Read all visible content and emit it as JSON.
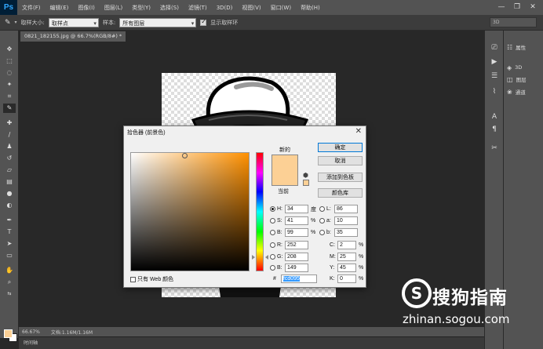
{
  "app": {
    "logo": "Ps"
  },
  "menu": [
    "文件(F)",
    "编辑(E)",
    "图像(I)",
    "图层(L)",
    "类型(Y)",
    "选择(S)",
    "滤镜(T)",
    "3D(D)",
    "视图(V)",
    "窗口(W)",
    "帮助(H)"
  ],
  "window_controls": {
    "minimize": "—",
    "restore": "❐",
    "close": "✕"
  },
  "options": {
    "sample_size_label": "取样大小:",
    "sample_size_value": "取样点",
    "sample_label": "样本:",
    "sample_value": "所有图层",
    "show_ring_label": "显示取样环",
    "show_ring_checked": true,
    "workspace": "3D"
  },
  "document": {
    "tab": "0821_182155.jpg @ 66.7%(RGB/8#) *"
  },
  "status": {
    "zoom": "66.67%",
    "doc": "文档:1.16M/1.16M"
  },
  "timeline": "时间轴",
  "panels": [
    {
      "icon": "properties-icon",
      "label": "属性"
    },
    {
      "icon": "3d-icon",
      "label": "3D"
    },
    {
      "icon": "layers-icon",
      "label": "图层"
    },
    {
      "icon": "channels-icon",
      "label": "通道"
    }
  ],
  "dialog": {
    "title": "拾色器 (前景色)",
    "new_label": "新的",
    "current_label": "当前",
    "buttons": {
      "ok": "确定",
      "cancel": "取消",
      "add_swatch": "添加到色板",
      "libraries": "颜色库"
    },
    "web_only_label": "只有 Web 颜色",
    "hsb": {
      "h_label": "H:",
      "h": "34",
      "h_unit": "度",
      "s_label": "S:",
      "s": "41",
      "s_unit": "%",
      "b_label": "B:",
      "b": "99",
      "b_unit": "%"
    },
    "rgb": {
      "r_label": "R:",
      "r": "252",
      "g_label": "G:",
      "g": "208",
      "b_label": "B:",
      "b": "149"
    },
    "lab": {
      "l_label": "L:",
      "l": "86",
      "a_label": "a:",
      "a": "10",
      "b_label": "b:",
      "b": "35"
    },
    "cmyk": {
      "c_label": "C:",
      "c": "2",
      "m_label": "M:",
      "m": "25",
      "y_label": "Y:",
      "y": "45",
      "k_label": "K:",
      "k": "0",
      "unit": "%"
    },
    "hex_label": "#",
    "hex": "fcd095",
    "selected_color": "#fcd095"
  },
  "watermark": {
    "brand": "搜狗指南",
    "url": "zhinan.sogou.com"
  }
}
